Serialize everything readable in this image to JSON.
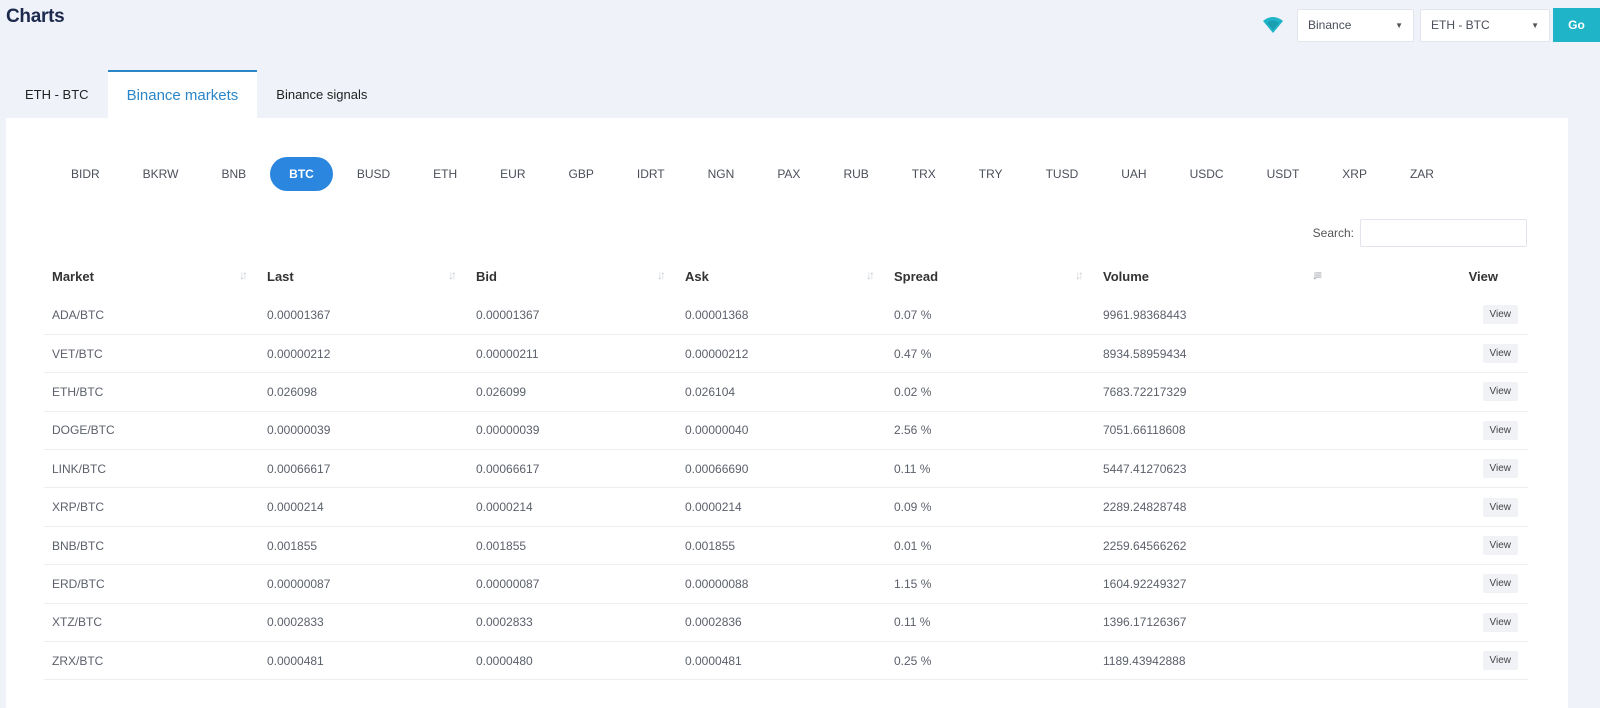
{
  "header": {
    "title": "Charts",
    "exchange_select": "Binance",
    "pair_select": "ETH - BTC",
    "go_label": "Go",
    "signal_icon": "signal-wifi-icon",
    "accent_color": "#20b4c8"
  },
  "tabs": [
    {
      "label": "ETH - BTC",
      "active": false
    },
    {
      "label": "Binance markets",
      "active": true
    },
    {
      "label": "Binance signals",
      "active": false
    }
  ],
  "currencies": {
    "items": [
      "BIDR",
      "BKRW",
      "BNB",
      "BTC",
      "BUSD",
      "ETH",
      "EUR",
      "GBP",
      "IDRT",
      "NGN",
      "PAX",
      "RUB",
      "TRX",
      "TRY",
      "TUSD",
      "UAH",
      "USDC",
      "USDT",
      "XRP",
      "ZAR"
    ],
    "selected": "BTC"
  },
  "search": {
    "label": "Search:",
    "value": ""
  },
  "table": {
    "columns": [
      "Market",
      "Last",
      "Bid",
      "Ask",
      "Spread",
      "Volume",
      "View"
    ],
    "sorted_column": "Volume",
    "sort_direction": "descending",
    "rows": [
      {
        "market": "ADA/BTC",
        "last": "0.00001367",
        "last_trend": "up",
        "bid": "0.00001367",
        "ask": "0.00001368",
        "spread": "0.07 %",
        "volume": "9961.98368443",
        "view": "View"
      },
      {
        "market": "VET/BTC",
        "last": "0.00000212",
        "last_trend": "up",
        "bid": "0.00000211",
        "ask": "0.00000212",
        "spread": "0.47 %",
        "volume": "8934.58959434",
        "view": "View"
      },
      {
        "market": "ETH/BTC",
        "last": "0.026098",
        "last_trend": "up",
        "bid": "0.026099",
        "ask": "0.026104",
        "spread": "0.02 %",
        "volume": "7683.72217329",
        "view": "View"
      },
      {
        "market": "DOGE/BTC",
        "last": "0.00000039",
        "last_trend": "up",
        "bid": "0.00000039",
        "ask": "0.00000040",
        "spread": "2.56 %",
        "volume": "7051.66118608",
        "view": "View"
      },
      {
        "market": "LINK/BTC",
        "last": "0.00066617",
        "last_trend": "down",
        "bid": "0.00066617",
        "ask": "0.00066690",
        "spread": "0.11 %",
        "volume": "5447.41270623",
        "view": "View"
      },
      {
        "market": "XRP/BTC",
        "last": "0.0000214",
        "last_trend": "up",
        "bid": "0.0000214",
        "ask": "0.0000214",
        "spread": "0.09 %",
        "volume": "2289.24828748",
        "view": "View"
      },
      {
        "market": "BNB/BTC",
        "last": "0.001855",
        "last_trend": "up",
        "bid": "0.001855",
        "ask": "0.001855",
        "spread": "0.01 %",
        "volume": "2259.64566262",
        "view": "View"
      },
      {
        "market": "ERD/BTC",
        "last": "0.00000087",
        "last_trend": "up",
        "bid": "0.00000087",
        "ask": "0.00000088",
        "spread": "1.15 %",
        "volume": "1604.92249327",
        "view": "View"
      },
      {
        "market": "XTZ/BTC",
        "last": "0.0002833",
        "last_trend": "down",
        "bid": "0.0002833",
        "ask": "0.0002836",
        "spread": "0.11 %",
        "volume": "1396.17126367",
        "view": "View"
      },
      {
        "market": "ZRX/BTC",
        "last": "0.0000481",
        "last_trend": "up",
        "bid": "0.0000480",
        "ask": "0.0000481",
        "spread": "0.25 %",
        "volume": "1189.43942888",
        "view": "View"
      }
    ]
  },
  "colors": {
    "up": "#27a78b",
    "down": "#f39a73",
    "link": "#2b6ea8",
    "pill_active": "#2a86de"
  }
}
